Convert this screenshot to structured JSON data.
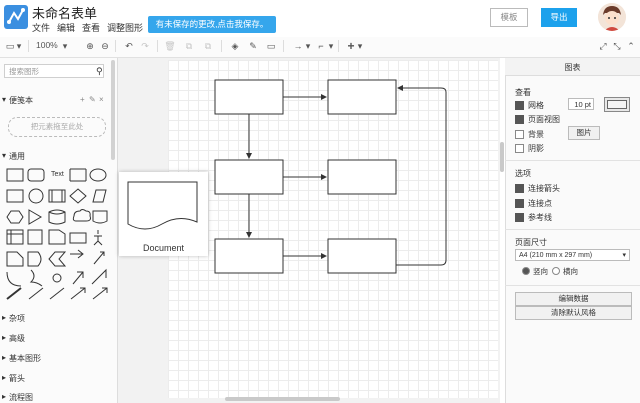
{
  "app": {
    "title": "未命名表单",
    "menu": [
      "文件",
      "编辑",
      "查看",
      "调整图形"
    ],
    "unsaved_banner": "有未保存的更改,点击我保存。",
    "template_button": "模板",
    "export_button": "导出"
  },
  "toolbar": {
    "zoom": "100%"
  },
  "left_panel": {
    "search_placeholder": "搜索图形",
    "scratchpad_label": "便笺本",
    "dropzone_text": "把元素拖至此处",
    "general_label": "通用",
    "text_shape_label": "Text",
    "categories": [
      "杂项",
      "高级",
      "基本图形",
      "箭头",
      "流程图"
    ]
  },
  "popup": {
    "label": "Document"
  },
  "right_panel": {
    "title": "图表",
    "view_heading": "查看",
    "grid_label": "网格",
    "grid_size": "10 pt",
    "page_view_label": "页面视图",
    "background_label": "背景",
    "image_button": "图片",
    "shadow_label": "阴影",
    "options_heading": "选项",
    "connection_arrows_label": "连接箭头",
    "connection_points_label": "连接点",
    "guides_label": "参考线",
    "page_size_heading": "页面尺寸",
    "page_size_value": "A4 (210 mm x 297 mm)",
    "portrait_label": "竖向",
    "landscape_label": "横向",
    "edit_data_button": "编辑数据",
    "clear_style_button": "清除默认风格"
  }
}
